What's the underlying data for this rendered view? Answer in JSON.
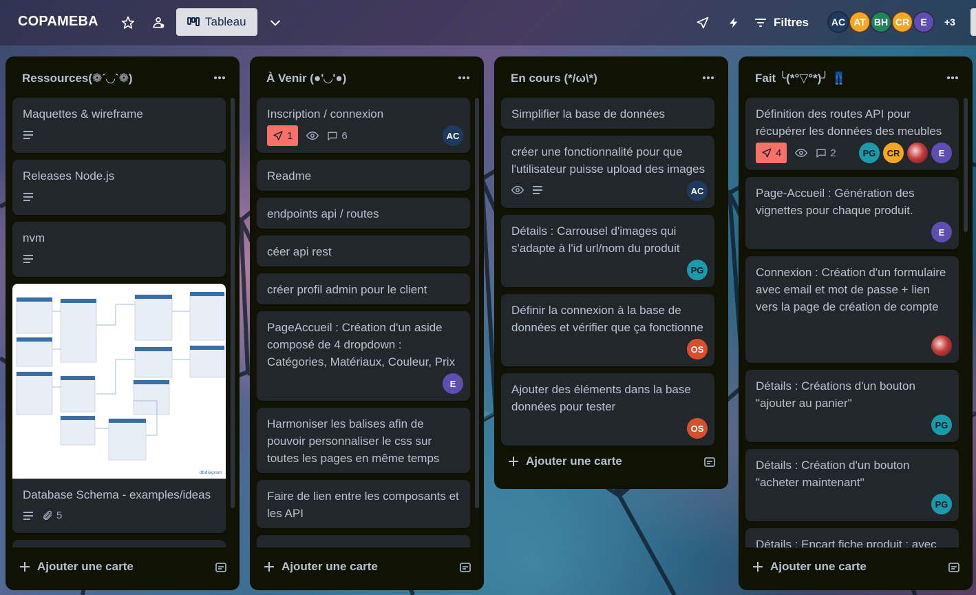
{
  "header": {
    "board_title": "COPAMEBA",
    "view_label": "Tableau",
    "filters_label": "Filtres",
    "members": [
      {
        "initials": "AC",
        "color": "#1e3a5f"
      },
      {
        "initials": "AT",
        "color": "#f5a623"
      },
      {
        "initials": "BH",
        "color": "#1f845a"
      },
      {
        "initials": "CR",
        "color": "#f5a623"
      },
      {
        "initials": "E",
        "color": "#5e4db2"
      }
    ],
    "members_more": "+3",
    "icons": [
      "star-icon",
      "workspace-visibility-icon",
      "board-view-icon",
      "chevron-down-icon",
      "power-ups-icon",
      "automation-icon",
      "filter-icon"
    ]
  },
  "lists": [
    {
      "title": "Ressources(❁´◡`❁)",
      "add_card": "Ajouter une carte",
      "cards": [
        {
          "title": "Maquettes & wireframe",
          "description_icon": true
        },
        {
          "title": "Releases Node.js",
          "description_icon": true
        },
        {
          "title": "nvm",
          "description_icon": true
        },
        {
          "title": "Database Schema - examples/ideas",
          "attachments": "5",
          "cover_watermark": "dbdiagram"
        }
      ]
    },
    {
      "title": "À Venir (●'◡'●)",
      "add_card": "Ajouter une carte",
      "cards": [
        {
          "title": "Inscription / connexion",
          "checklist": "1",
          "comments": "6",
          "members": [
            "AC"
          ]
        },
        {
          "title": "Readme"
        },
        {
          "title": "endpoints api / routes"
        },
        {
          "title": "céer api rest"
        },
        {
          "title": "créer profil admin pour le client"
        },
        {
          "title": "PageAccueil : Création d'un aside composé de 4 dropdown : Catégories, Matériaux, Couleur, Prix",
          "members": [
            "E"
          ]
        },
        {
          "title": "Harmoniser les balises afin de pouvoir personnaliser le css sur toutes les pages en même temps"
        },
        {
          "title": "Faire de lien entre les composants et les API"
        }
      ]
    },
    {
      "title": "En cours (*/ω\\*)",
      "add_card": "Ajouter une carte",
      "cards": [
        {
          "title": "Simplifier la base de données"
        },
        {
          "title": "créer une fonctionnalité pour que l'utilisateur puisse upload des images",
          "members": [
            "AC"
          ]
        },
        {
          "title": "Détails : Carrousel d'images qui s'adapte à l'id url/nom du produit",
          "members": [
            "PG"
          ]
        },
        {
          "title": "Définir la connexion à la base de données et vérifier que ça fonctionne",
          "members": [
            "OS"
          ]
        },
        {
          "title": "Ajouter des éléments dans la base données pour tester",
          "members": [
            "OS"
          ]
        }
      ]
    },
    {
      "title": "Fait ╰(*°▽°*)╯ 👖",
      "add_card": "Ajouter une carte",
      "cards": [
        {
          "title": "Définition des routes API pour récupérer les données des meubles",
          "checklist": "4",
          "comments": "2",
          "members": [
            "PG",
            "CR",
            "photo",
            "E"
          ]
        },
        {
          "title": "Page-Accueil : Génération des vignettes pour chaque produit.",
          "members": [
            "E"
          ]
        },
        {
          "title": "Connexion : Création d'un formulaire avec email et mot de passe + lien vers la page de création de compte",
          "members": [
            "photo"
          ]
        },
        {
          "title": "Détails : Créations d'un bouton \"ajouter au panier\"",
          "members": [
            "PG"
          ]
        },
        {
          "title": "Détails : Création d'un bouton \"acheter maintenant\"",
          "members": [
            "PG"
          ]
        },
        {
          "title": "Détails : Encart fiche produit : avec"
        }
      ]
    }
  ],
  "colors": {
    "list_bg": "#101204",
    "card_bg": "#22272b",
    "text": "#b6c2cf",
    "badge_red": "#f87168"
  }
}
